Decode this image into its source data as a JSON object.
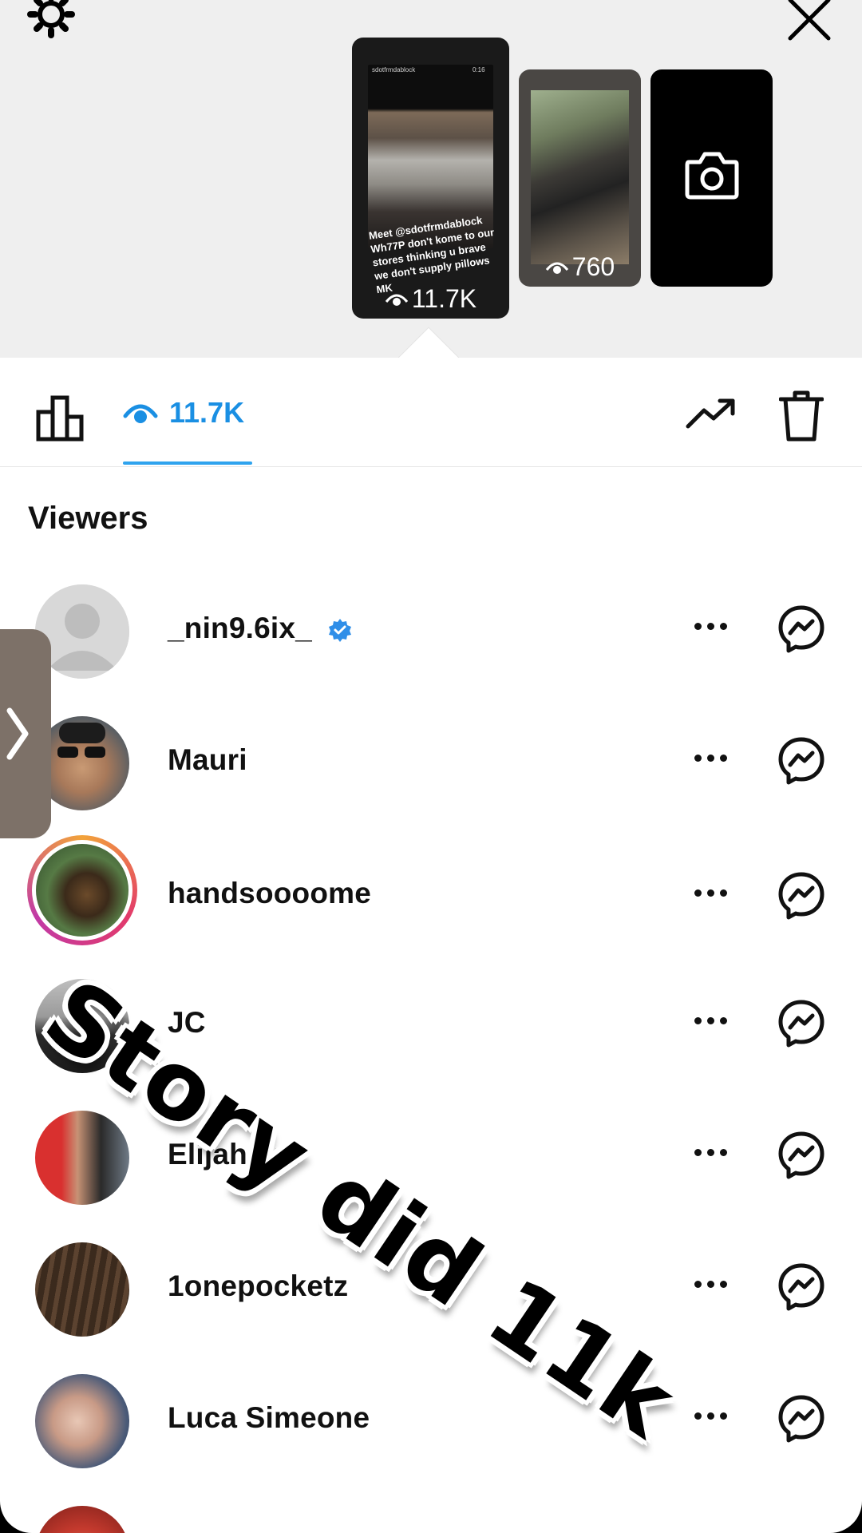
{
  "story_previews": {
    "main": {
      "caption_user": "sdotfrmdablock",
      "caption_time": "0:16",
      "caption_text": "Meet @sdotfrmdablock Wh77P don't kome to our stores thinking u brave we don't supply pillows MK",
      "views": "11.7K"
    },
    "second": {
      "views": "760"
    },
    "third": {
      "icon": "camera-icon"
    }
  },
  "tabs": {
    "insights_icon": "bar-chart-icon",
    "views_label": "11.7K",
    "promote_icon": "trending-icon",
    "delete_icon": "trash-icon",
    "active_color": "#1a8fe3"
  },
  "viewers": {
    "title": "Viewers",
    "items": [
      {
        "name": "_nin9.6ix_",
        "verified": true
      },
      {
        "name": "Mauri"
      },
      {
        "name": "handsoooome"
      },
      {
        "name": "JC"
      },
      {
        "name": "Elijah Lui"
      },
      {
        "name": "1onepocketz"
      },
      {
        "name": "Luca Simeone"
      }
    ]
  },
  "overlay": {
    "text": "Story did 11k"
  }
}
